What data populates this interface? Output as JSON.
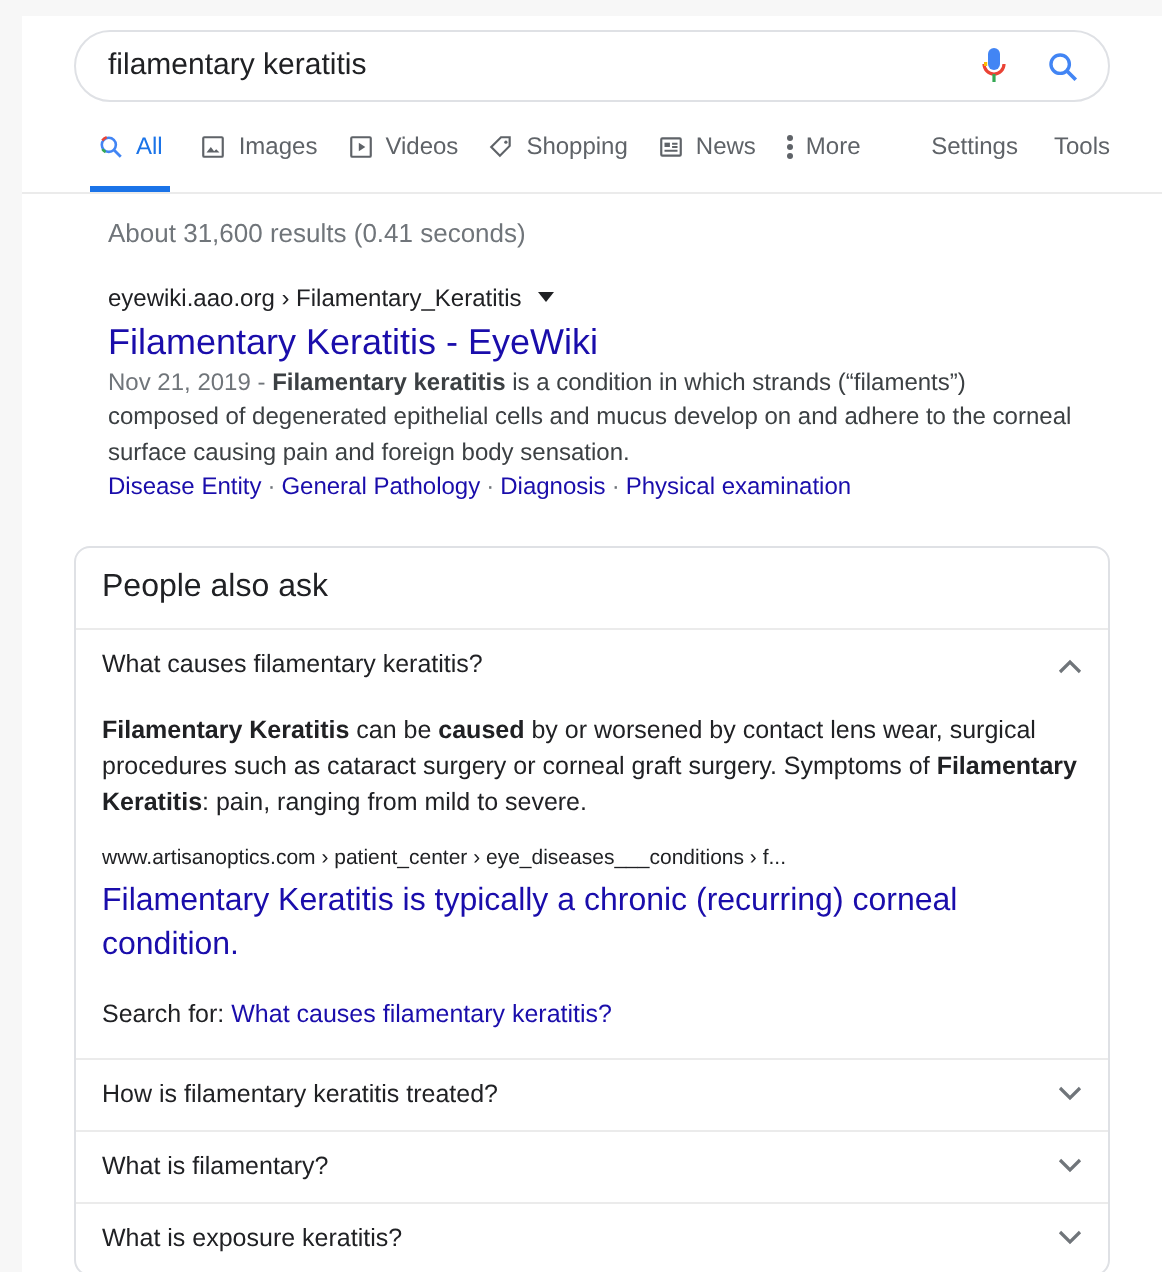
{
  "search": {
    "value": "filamentary keratitis"
  },
  "tabs": [
    {
      "label": "All",
      "kind": "search",
      "selected": true
    },
    {
      "label": "Images",
      "kind": "image",
      "selected": false
    },
    {
      "label": "Videos",
      "kind": "video",
      "selected": false
    },
    {
      "label": "Shopping",
      "kind": "tag",
      "selected": false
    },
    {
      "label": "News",
      "kind": "news",
      "selected": false
    },
    {
      "label": "More",
      "kind": "more",
      "selected": false
    }
  ],
  "tools": [
    "Settings",
    "Tools"
  ],
  "result_stats": "About 31,600 results (0.41 seconds)",
  "result": {
    "breadcrumb": "eyewiki.aao.org › Filamentary_Keratitis",
    "title": "Filamentary Keratitis - EyeWiki",
    "date": "Nov 21, 2019 - ",
    "snippet": "**Filamentary keratitis** is a condition in which strands (“filaments”) composed of degenerated epithelial cells and mucus develop on and adhere to the corneal surface causing pain and foreign body sensation.",
    "sitelink_separator": "·",
    "sitelinks": [
      "Disease Entity",
      "General Pathology",
      "Diagnosis",
      "Physical examination"
    ]
  },
  "people_also_ask": {
    "title": "People also ask",
    "questions": [
      {
        "question": "What causes filamentary keratitis?",
        "expanded": true,
        "answer": "**Filamentary Keratitis** can be **caused** by or worsened by contact lens wear, surgical procedures such as cataract surgery or corneal graft surgery. Symptoms of **Filamentary Keratitis**: pain, ranging from mild to severe.",
        "source": "www.artisanoptics.com › patient_center › eye_diseases___conditions › f...",
        "link": "Filamentary Keratitis is typically a chronic (recurring) corneal condition.",
        "search_for_label": "Search for:",
        "search_for": "What causes filamentary keratitis?"
      },
      {
        "question": "How is filamentary keratitis treated?",
        "expanded": false
      },
      {
        "question": "What is filamentary?",
        "expanded": false
      },
      {
        "question": "What is exposure keratitis?",
        "expanded": false
      }
    ]
  }
}
